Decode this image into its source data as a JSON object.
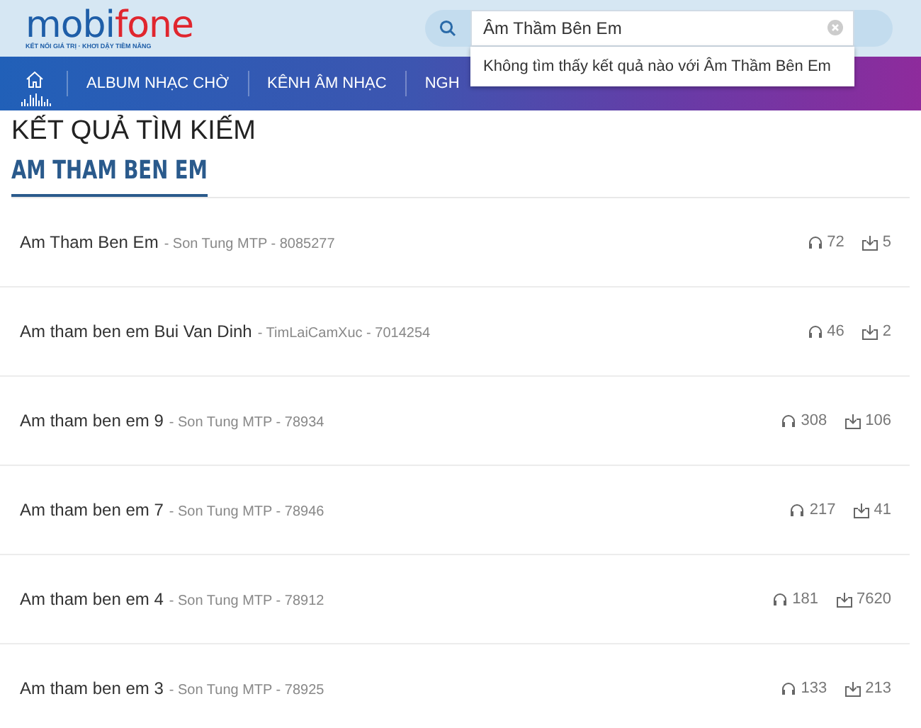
{
  "logo": {
    "brand_main": "mobi",
    "brand_accent": "fone",
    "tagline": "KẾT NỐI GIÁ TRỊ · KHƠI DẬY TIỀM NĂNG"
  },
  "search": {
    "value": "Âm Thầm Bên Em",
    "suggestion": "Không tìm thấy kết quả nào với Âm Thầm Bên Em"
  },
  "nav": [
    {
      "label": "ALBUM NHẠC CHỜ"
    },
    {
      "label": "KÊNH ÂM NHẠC"
    },
    {
      "label": "NGH"
    }
  ],
  "page_title": "KẾT QUẢ TÌM KIẾM",
  "query_heading": "AM THAM BEN EM",
  "results": [
    {
      "title": "Am Tham Ben Em",
      "meta": "- Son Tung MTP - 8085277",
      "listens": "72",
      "downloads": "5"
    },
    {
      "title": "Am tham ben em Bui Van Dinh",
      "meta": "- TimLaiCamXuc - 7014254",
      "listens": "46",
      "downloads": "2"
    },
    {
      "title": "Am tham ben em 9",
      "meta": "- Son Tung MTP - 78934",
      "listens": "308",
      "downloads": "106"
    },
    {
      "title": "Am tham ben em 7",
      "meta": "- Son Tung MTP - 78946",
      "listens": "217",
      "downloads": "41"
    },
    {
      "title": "Am tham ben em 4",
      "meta": "- Son Tung MTP - 78912",
      "listens": "181",
      "downloads": "7620"
    },
    {
      "title": "Am tham ben em 3",
      "meta": "- Son Tung MTP - 78925",
      "listens": "133",
      "downloads": "213"
    }
  ]
}
